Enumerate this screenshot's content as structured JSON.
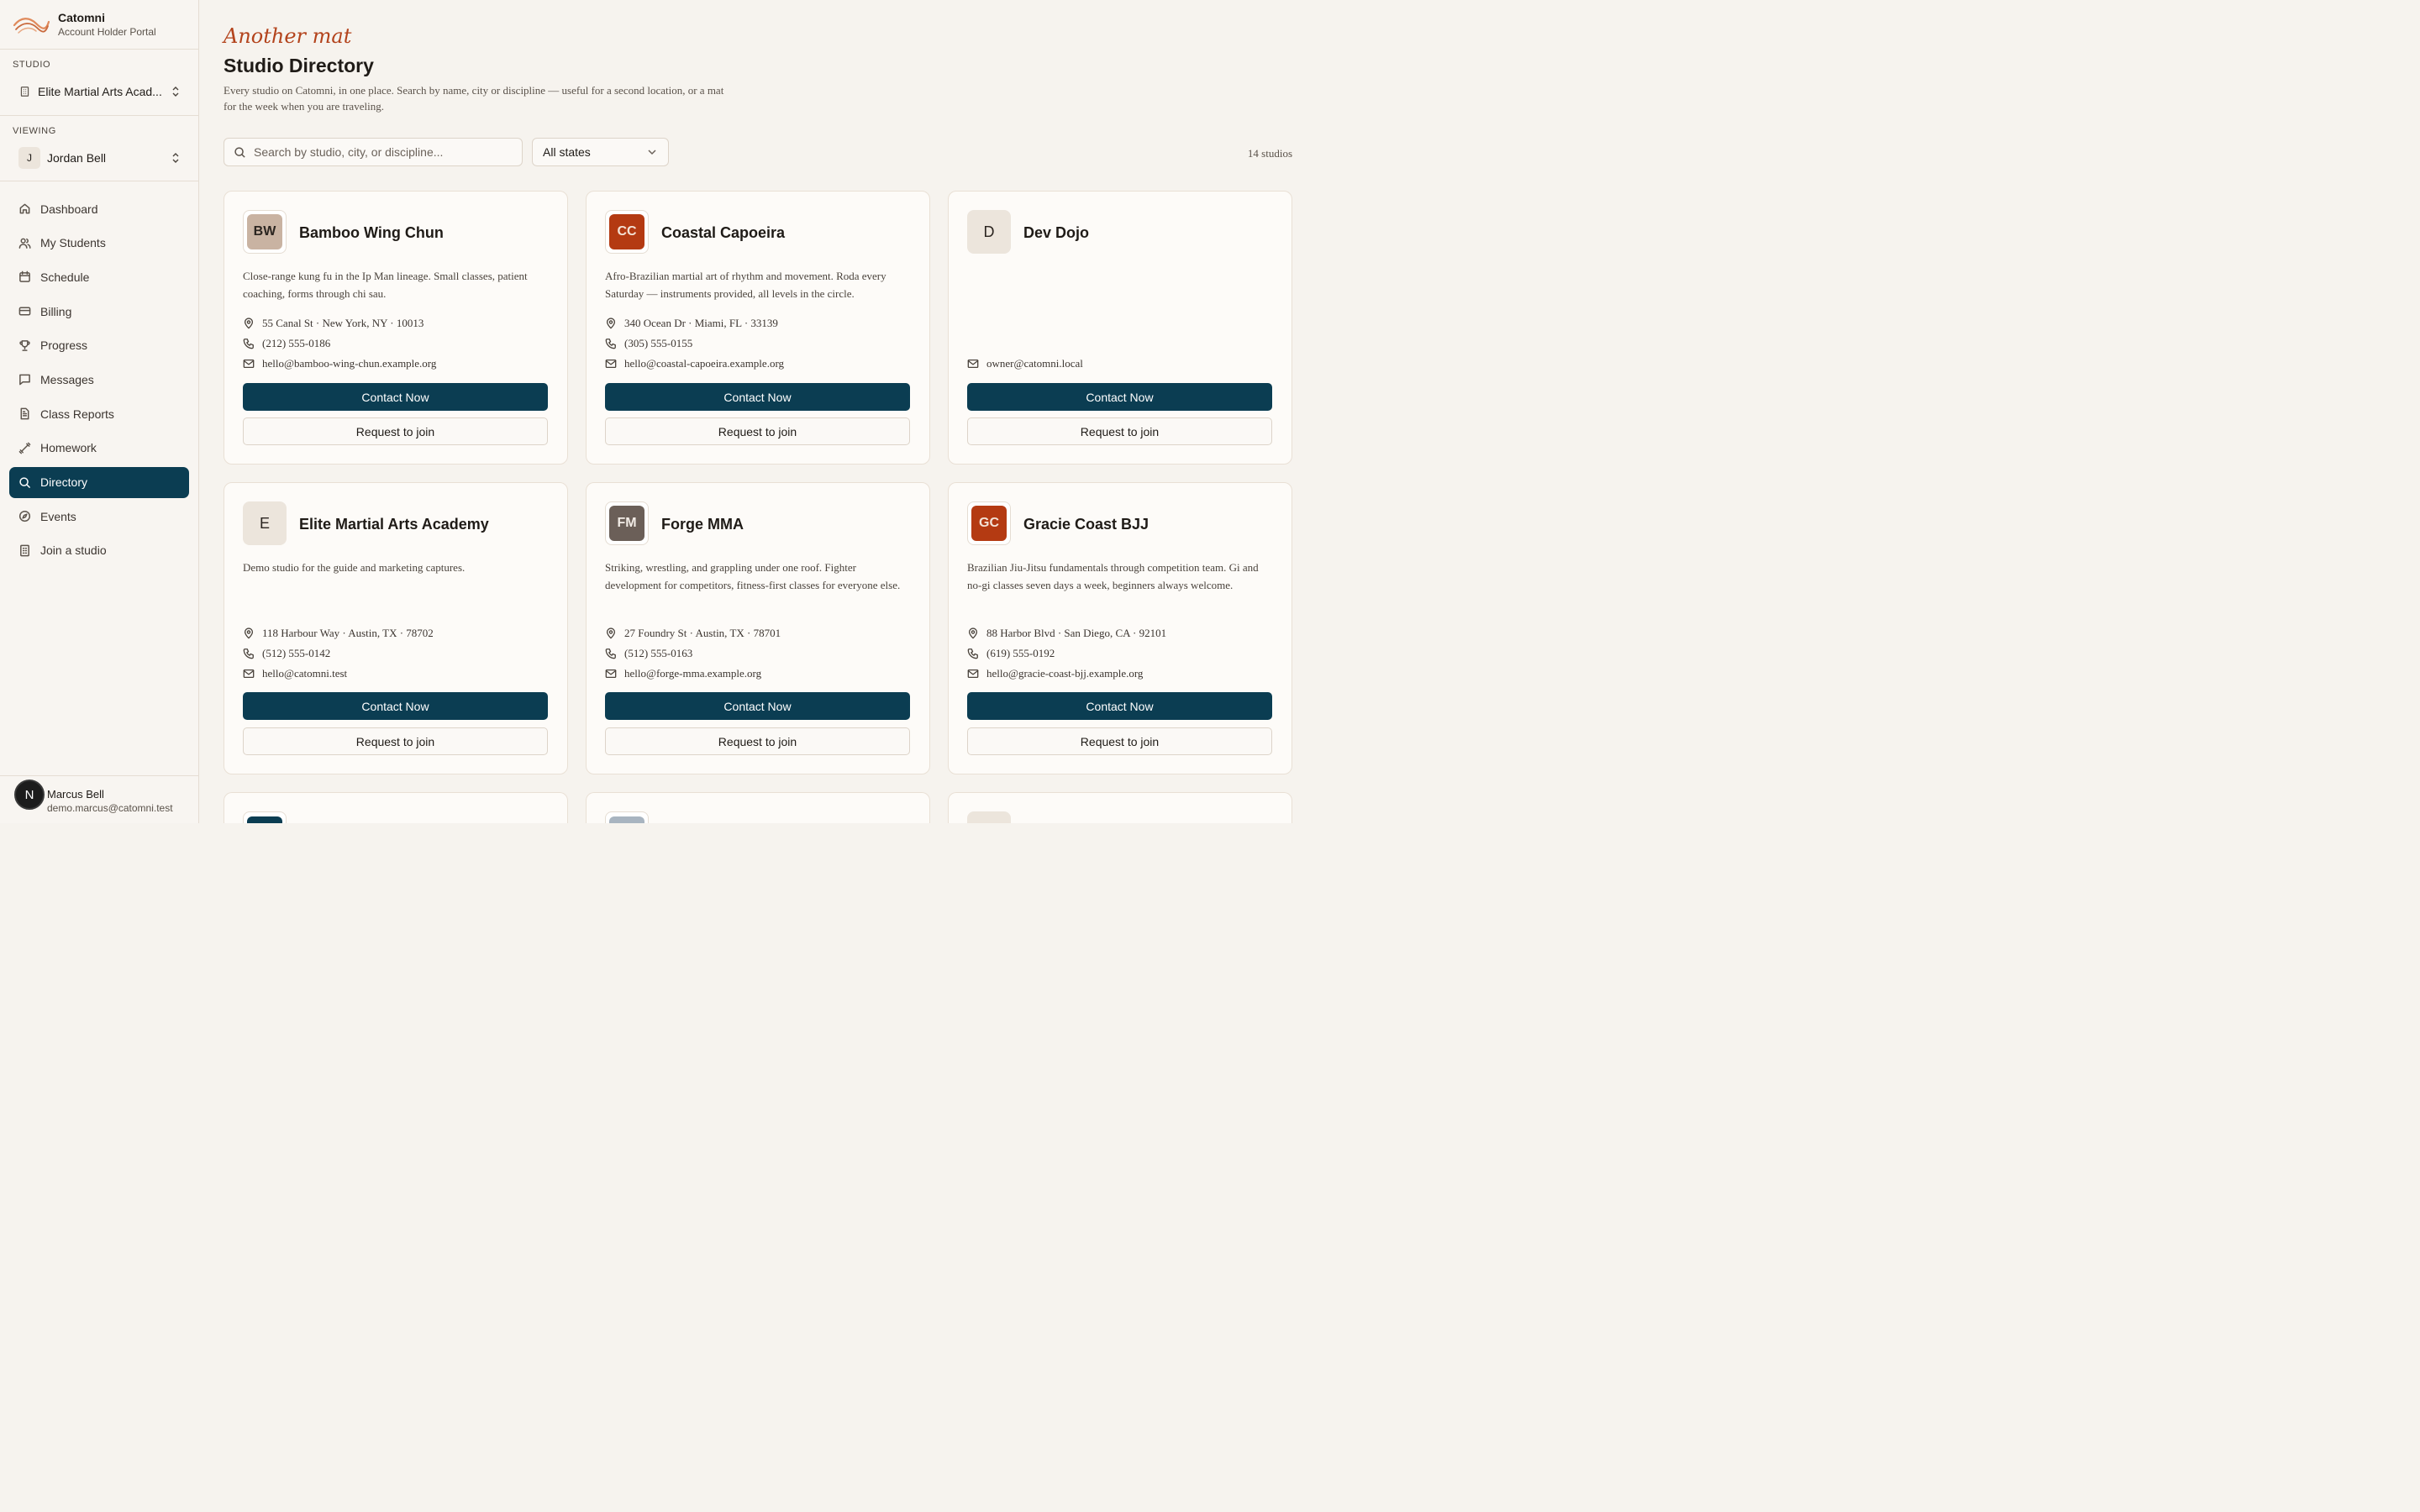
{
  "brand": {
    "name": "Catomni",
    "subtitle": "Account Holder Portal"
  },
  "studio_switcher": {
    "label": "STUDIO",
    "value": "Elite Martial Arts Acad..."
  },
  "viewing_switcher": {
    "label": "VIEWING",
    "initial": "J",
    "value": "Jordan Bell"
  },
  "nav": [
    {
      "label": "Dashboard",
      "icon": "home-icon"
    },
    {
      "label": "My Students",
      "icon": "users-icon"
    },
    {
      "label": "Schedule",
      "icon": "calendar-icon"
    },
    {
      "label": "Billing",
      "icon": "card-icon"
    },
    {
      "label": "Progress",
      "icon": "trophy-icon"
    },
    {
      "label": "Messages",
      "icon": "message-icon"
    },
    {
      "label": "Class Reports",
      "icon": "report-icon"
    },
    {
      "label": "Homework",
      "icon": "dumbbell-icon"
    },
    {
      "label": "Directory",
      "icon": "search-icon",
      "active": true
    },
    {
      "label": "Events",
      "icon": "compass-icon"
    },
    {
      "label": "Join a studio",
      "icon": "building-icon"
    }
  ],
  "user": {
    "initial": "N",
    "name": "Marcus Bell",
    "email": "demo.marcus@catomni.test"
  },
  "page": {
    "tagline": "Another mat",
    "title": "Studio Directory",
    "description": "Every studio on Catomni, in one place. Search by name, city or discipline — useful for a second location, or a mat for the week when you are traveling."
  },
  "filters": {
    "search_placeholder": "Search by studio, city, or discipline...",
    "state_value": "All states",
    "count": "14 studios"
  },
  "buttons": {
    "contact": "Contact Now",
    "join": "Request to join"
  },
  "studios": [
    {
      "initials": "BW",
      "logo_bg": "#c9b3a2",
      "logo_fg": "#2b2520",
      "name": "Bamboo Wing Chun",
      "description": "Close-range kung fu in the Ip Man lineage. Small classes, patient coaching, forms through chi sau.",
      "address": "55 Canal St · New York, NY · 10013",
      "phone": "(212) 555-0186",
      "email": "hello@bamboo-wing-chun.example.org"
    },
    {
      "initials": "CC",
      "logo_bg": "#b43a12",
      "logo_fg": "#f3e2d6",
      "name": "Coastal Capoeira",
      "description": "Afro-Brazilian martial art of rhythm and movement. Roda every Saturday — instruments provided, all levels in the circle.",
      "address": "340 Ocean Dr · Miami, FL · 33139",
      "phone": "(305) 555-0155",
      "email": "hello@coastal-capoeira.example.org"
    },
    {
      "initials": "D",
      "name": "Dev Dojo",
      "plain": true,
      "description": "",
      "address": "",
      "phone": "",
      "email": "owner@catomni.local"
    },
    {
      "initials": "E",
      "name": "Elite Martial Arts Academy",
      "plain": true,
      "description": "Demo studio for the guide and marketing captures.",
      "address": "118 Harbour Way · Austin, TX · 78702",
      "phone": "(512) 555-0142",
      "email": "hello@catomni.test"
    },
    {
      "initials": "FM",
      "logo_bg": "#6b5f58",
      "logo_fg": "#f2ece6",
      "name": "Forge MMA",
      "description": "Striking, wrestling, and grappling under one roof. Fighter development for competitors, fitness-first classes for everyone else.",
      "address": "27 Foundry St · Austin, TX · 78701",
      "phone": "(512) 555-0163",
      "email": "hello@forge-mma.example.org"
    },
    {
      "initials": "GC",
      "logo_bg": "#b43a12",
      "logo_fg": "#f3e2d6",
      "name": "Gracie Coast BJJ",
      "description": "Brazilian Jiu-Jitsu fundamentals through competition team. Gi and no-gi classes seven days a week, beginners always welcome.",
      "address": "88 Harbor Blvd · San Diego, CA · 92101",
      "phone": "(619) 555-0192",
      "email": "hello@gracie-coast-bjj.example.org"
    }
  ],
  "colors": {
    "primary": "#0b3d52",
    "accent": "#b3431c",
    "background": "#f6f3ee"
  }
}
